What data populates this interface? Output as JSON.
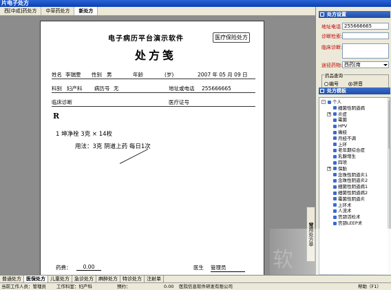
{
  "window": {
    "title": "片电子处方"
  },
  "top_tabs": [
    {
      "label": "西[中成]药处方"
    },
    {
      "label": "中草药处方"
    },
    {
      "label": "新处方"
    }
  ],
  "prescription": {
    "software_title": "电子病历平台演示软件",
    "insurance_button": "医疗保险处方",
    "form_title": "处方笺",
    "row1": {
      "name_label": "姓名",
      "name": "李瑞雯",
      "gender_label": "性别",
      "gender": "男",
      "age_label": "年龄",
      "age_unit": "(岁)",
      "date": "2007 年 05 月 09 日"
    },
    "row2": {
      "dept_label": "科别",
      "dept": "妇产科",
      "record_label": "病历号",
      "record": "无",
      "address_label": "地址或电话",
      "phone": "255666665"
    },
    "row3": {
      "diagnosis_label": "临床诊断",
      "insurance_label": "医疗证号"
    },
    "rx_mark": "R",
    "medicine": "1  坤净栓    3克 × 14枚",
    "usage": "用法：3克    阴道上药    每日1次",
    "fee_label": "药费：",
    "fee_value": "0.00",
    "doctor_label": "医生",
    "doctor_value": "管理员"
  },
  "side_vertical_tab": "常用处方单",
  "right_panel": {
    "settings_title": "处方设置",
    "phone_label": "地址电话",
    "phone_value": "255666665",
    "diag_label": "诊断检索:",
    "clinical_label": "临床诊断:",
    "route_label": "途径药物:",
    "route_value": "西药[南",
    "group_label": "药品查询",
    "radio_a": "编号",
    "radio_b": "拼音",
    "template_title": "处方模板",
    "tree": [
      {
        "label": "个人",
        "level": 0,
        "expander": "-"
      },
      {
        "label": "细菌性阴道病",
        "level": 1
      },
      {
        "label": "炎症",
        "level": 1,
        "expander": "+"
      },
      {
        "label": "霉菌",
        "level": 1
      },
      {
        "label": "HPV",
        "level": 1
      },
      {
        "label": "痛经",
        "level": 1
      },
      {
        "label": "月经不调",
        "level": 1
      },
      {
        "label": "上环",
        "level": 1
      },
      {
        "label": "老年期综合症",
        "level": 1
      },
      {
        "label": "乳腺增生",
        "level": 1
      },
      {
        "label": "四项",
        "level": 1
      },
      {
        "label": "保胎",
        "level": 1,
        "expander": "+"
      },
      {
        "label": "念珠性阴道炎1",
        "level": 1
      },
      {
        "label": "念珠性阴道炎2",
        "level": 1
      },
      {
        "label": "细菌性阴道病1",
        "level": 1
      },
      {
        "label": "细菌性阴道病2",
        "level": 1
      },
      {
        "label": "霉菌性阴道炎",
        "level": 1
      },
      {
        "label": "上环术",
        "level": 1
      },
      {
        "label": "人流术",
        "level": 1
      },
      {
        "label": "宫颈活检术",
        "level": 1
      },
      {
        "label": "宫颈LEEP术",
        "level": 1
      }
    ]
  },
  "bottom_tabs": [
    {
      "label": "普通处方"
    },
    {
      "label": "医保处方"
    },
    {
      "label": "儿童处方"
    },
    {
      "label": "急诊处方"
    },
    {
      "label": "麻醉处方"
    },
    {
      "label": "特诊处方"
    },
    {
      "label": "注射单"
    }
  ],
  "status": {
    "user": "当前工作人员：管理员",
    "work": "工作科室：妇产科",
    "mid": "预约：",
    "num": "0.00",
    "company": "医院信息软件研发有限公司",
    "help": "帮助（F1）"
  }
}
